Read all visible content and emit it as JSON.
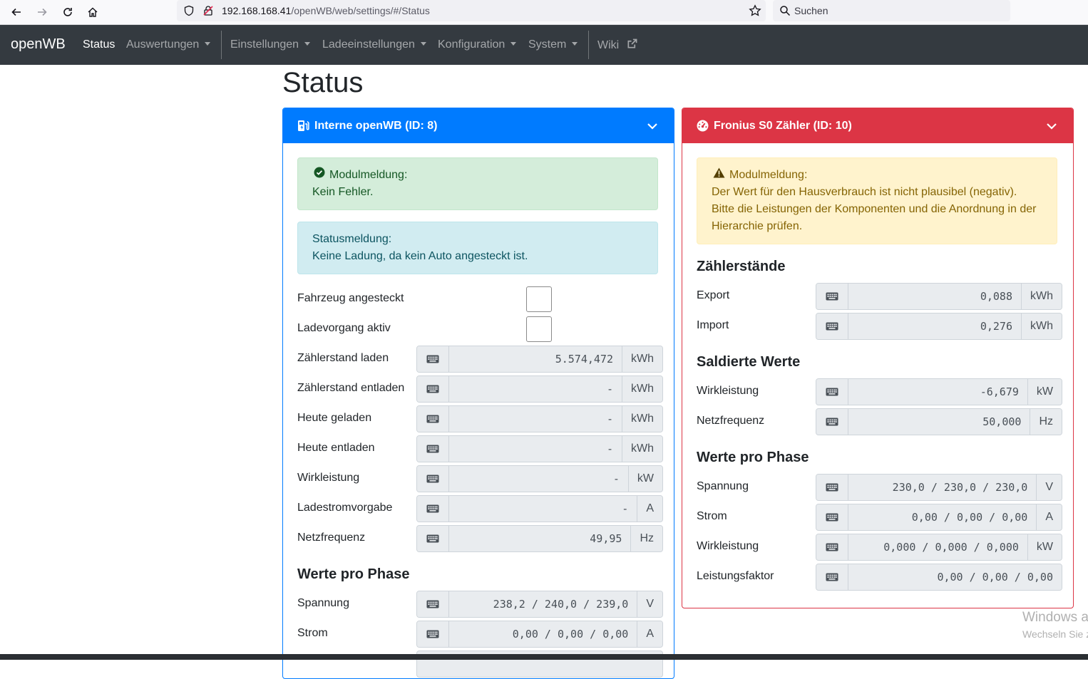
{
  "browser": {
    "url_host": "192.168.168.41",
    "url_path": "/openWB/web/settings/#/Status",
    "search_placeholder": "Suchen"
  },
  "navbar": {
    "brand": "openWB",
    "items": [
      {
        "label": "Status",
        "active": true,
        "dropdown": false
      },
      {
        "label": "Auswertungen",
        "dropdown": true
      },
      {
        "label": "Einstellungen",
        "dropdown": true
      },
      {
        "label": "Ladeeinstellungen",
        "dropdown": true
      },
      {
        "label": "Konfiguration",
        "dropdown": true
      },
      {
        "label": "System",
        "dropdown": true
      },
      {
        "label": "Wiki",
        "external": true
      }
    ]
  },
  "page": {
    "title": "Status"
  },
  "left_card": {
    "title": "Interne openWB (ID: 8)",
    "color": "#007bff",
    "module_alert": {
      "title": "Modulmeldung:",
      "text": "Kein Fehler."
    },
    "status_alert": {
      "title": "Statusmeldung:",
      "text": "Keine Ladung, da kein Auto angesteckt ist."
    },
    "checks": [
      {
        "label": "Fahrzeug angesteckt",
        "checked": false
      },
      {
        "label": "Ladevorgang aktiv",
        "checked": false
      }
    ],
    "fields": [
      {
        "label": "Zählerstand laden",
        "value": "5.574,472",
        "unit": "kWh"
      },
      {
        "label": "Zählerstand entladen",
        "value": "-",
        "unit": "kWh"
      },
      {
        "label": "Heute geladen",
        "value": "-",
        "unit": "kWh"
      },
      {
        "label": "Heute entladen",
        "value": "-",
        "unit": "kWh"
      },
      {
        "label": "Wirkleistung",
        "value": "-",
        "unit": "kW"
      },
      {
        "label": "Ladestromvorgabe",
        "value": "-",
        "unit": "A"
      },
      {
        "label": "Netzfrequenz",
        "value": "49,95",
        "unit": "Hz"
      }
    ],
    "phase_title": "Werte pro Phase",
    "phase_fields": [
      {
        "label": "Spannung",
        "value": "238,2 / 240,0 / 239,0",
        "unit": "V"
      },
      {
        "label": "Strom",
        "value": "0,00 / 0,00 / 0,00",
        "unit": "A"
      }
    ]
  },
  "right_card": {
    "title": "Fronius S0 Zähler (ID: 10)",
    "color": "#dc3545",
    "module_alert": {
      "title": "Modulmeldung:",
      "text": "Der Wert für den Hausverbrauch ist nicht plausibel (negativ). Bitte die Leistungen der Komponenten und die Anordnung in der Hierarchie prüfen."
    },
    "counters_title": "Zählerstände",
    "counters": [
      {
        "label": "Export",
        "value": "0,088",
        "unit": "kWh"
      },
      {
        "label": "Import",
        "value": "0,276",
        "unit": "kWh"
      }
    ],
    "balanced_title": "Saldierte Werte",
    "balanced": [
      {
        "label": "Wirkleistung",
        "value": "-6,679",
        "unit": "kW"
      },
      {
        "label": "Netzfrequenz",
        "value": "50,000",
        "unit": "Hz"
      }
    ],
    "phase_title": "Werte pro Phase",
    "phase_fields": [
      {
        "label": "Spannung",
        "value": "230,0 / 230,0 / 230,0",
        "unit": "V"
      },
      {
        "label": "Strom",
        "value": "0,00 / 0,00 / 0,00",
        "unit": "A"
      },
      {
        "label": "Wirkleistung",
        "value": "0,000 / 0,000 / 0,000",
        "unit": "kW"
      },
      {
        "label": "Leistungsfaktor",
        "value": "0,00 / 0,00 / 0,00",
        "unit": ""
      }
    ]
  },
  "os_watermark": {
    "line1": "Windows a",
    "line2": "Wechseln Sie z"
  }
}
